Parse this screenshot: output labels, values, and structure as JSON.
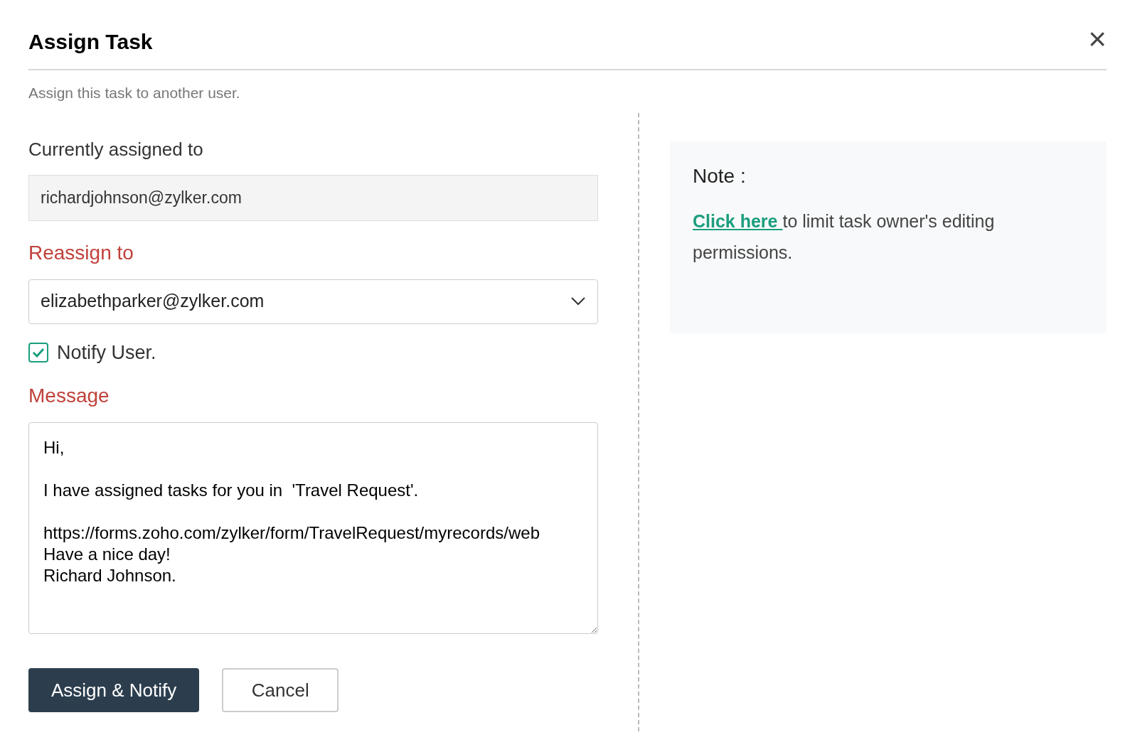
{
  "dialog": {
    "title": "Assign Task",
    "close": "×",
    "subtitle": "Assign this task to another user."
  },
  "form": {
    "current": {
      "label": "Currently assigned to",
      "value": "richardjohnson@zylker.com",
      "disabled": true
    },
    "reassign": {
      "label": "Reassign to",
      "value": "elizabethparker@zylker.com",
      "required": true
    },
    "notify": {
      "label": "Notify User.",
      "checked": true
    },
    "message": {
      "label": "Message",
      "required": true,
      "value": "Hi,\n\nI have assigned tasks for you in  'Travel Request'.\n\nhttps://forms.zoho.com/zylker/form/TravelRequest/myrecords/web\nHave a nice day!\nRichard Johnson."
    }
  },
  "buttons": [
    {
      "label": "Assign & Notify",
      "kind": "primary"
    },
    {
      "label": "Cancel",
      "kind": "secondary"
    }
  ],
  "note": {
    "title": "Note :",
    "link": "Click here ",
    "text": " to limit task owner's editing permissions."
  }
}
